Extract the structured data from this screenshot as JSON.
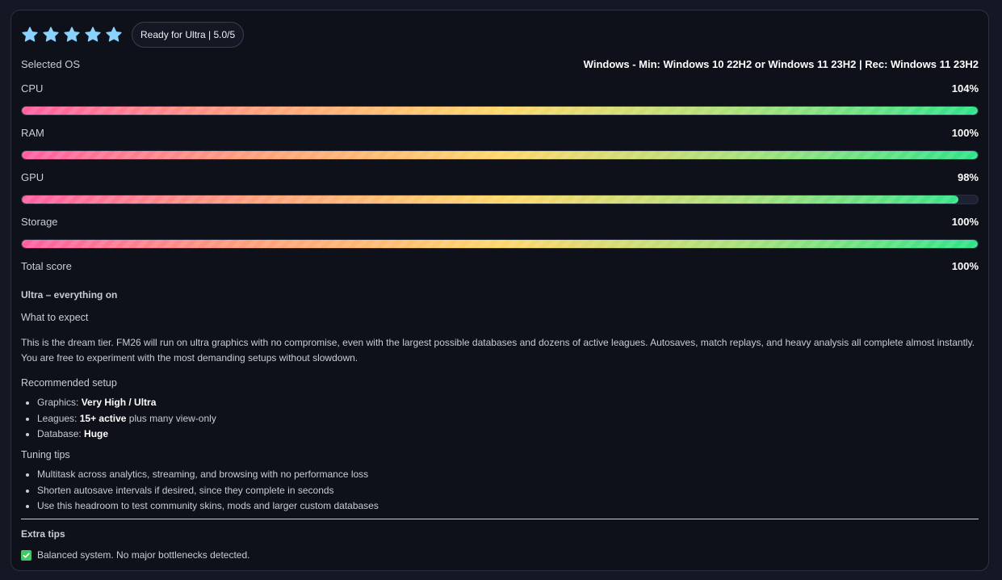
{
  "rating": {
    "stars": 5,
    "max_stars": 5,
    "star_color": "#8ad2ff",
    "badge": "Ready for Ultra | 5.0/5"
  },
  "os": {
    "label": "Selected OS",
    "value": "Windows - Min: Windows 10 22H2 or Windows 11 23H2 | Rec: Windows 11 23H2"
  },
  "meters": [
    {
      "label": "CPU",
      "value": "104%",
      "fill": 1.0
    },
    {
      "label": "RAM",
      "value": "100%",
      "fill": 1.0
    },
    {
      "label": "GPU",
      "value": "98%",
      "fill": 0.98
    },
    {
      "label": "Storage",
      "value": "100%",
      "fill": 1.0
    }
  ],
  "total": {
    "label": "Total score",
    "value": "100%"
  },
  "tier": {
    "title": "Ultra – everything on",
    "expect_heading": "What to expect",
    "description": "This is the dream tier. FM26 will run on ultra graphics with no compromise, even with the largest possible databases and dozens of active leagues. Autosaves, match replays, and heavy analysis all complete almost instantly. You are free to experiment with the most demanding setups without slowdown.",
    "setup_heading": "Recommended setup",
    "setup": [
      {
        "prefix": "Graphics: ",
        "bold": "Very High / Ultra",
        "suffix": ""
      },
      {
        "prefix": "Leagues: ",
        "bold": "15+ active",
        "suffix": " plus many view-only"
      },
      {
        "prefix": "Database: ",
        "bold": "Huge",
        "suffix": ""
      }
    ],
    "tips_heading": "Tuning tips",
    "tips": [
      "Multitask across analytics, streaming, and browsing with no performance loss",
      "Shorten autosave intervals if desired, since they complete in seconds",
      "Use this headroom to test community skins, mods and larger custom databases"
    ]
  },
  "extra": {
    "title": "Extra tips",
    "items": [
      {
        "icon": "check-icon",
        "text": "Balanced system. No major bottlenecks detected."
      }
    ]
  }
}
